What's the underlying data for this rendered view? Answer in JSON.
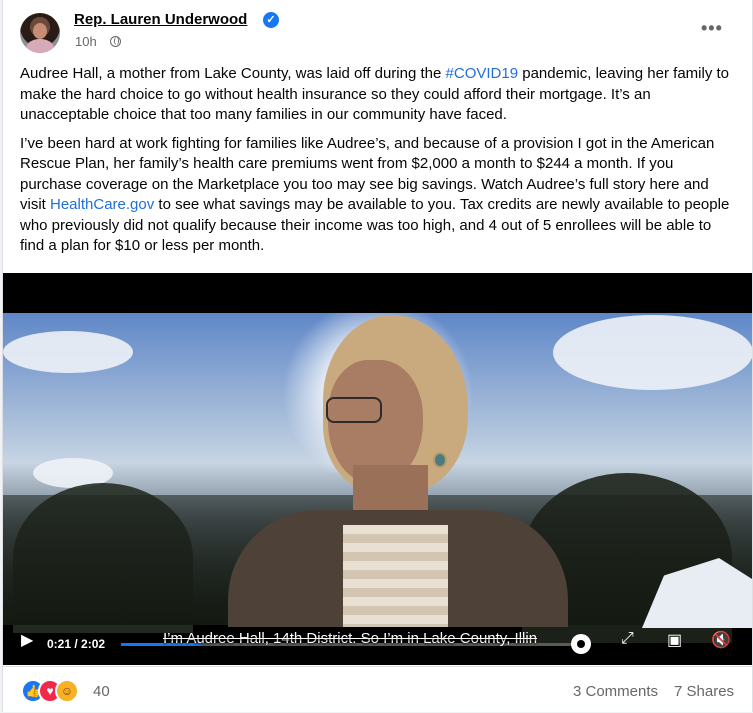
{
  "post": {
    "author": "Rep. Lauren Underwood",
    "time": "10h",
    "paragraphs": {
      "p1": {
        "before": "Audree Hall, a mother from Lake County, was laid off during the ",
        "hashtag": "#COVID19",
        "after": " pandemic, leaving her family to make the hard choice to go without health insurance so they could afford their mortgage. It’s an unacceptable choice that too many families in our community have faced."
      },
      "p2": {
        "before": "I’ve been hard at work fighting for families like Audree’s, and because of a provision I got in the American Rescue Plan, her family’s health care premiums went from $2,000 a month to $244 a month. If you purchase coverage on the Marketplace you too may see big savings. Watch Audree’s full story here and visit ",
        "link": "HealthCare.gov",
        "after": " to see what savings may be available to you. Tax credits are newly available to people who previously did not qualify because their income was too high, and 4 out of 5 enrollees will be able to find a plan for $10 or less per month."
      }
    }
  },
  "video": {
    "timecode": "0:21 / 2:02",
    "progress_fraction": 0.17,
    "caption": "I’m Audree Hall, 14th District. So I’m in Lake County, Illin"
  },
  "footer": {
    "reaction_count": "40",
    "comments": "3 Comments",
    "shares": "7 Shares"
  },
  "colors": {
    "accent": "#1877f2",
    "link": "#216fdb"
  },
  "icons": [
    "verified-icon",
    "public-globe-icon",
    "more-options-icon",
    "play-icon",
    "settings-icon",
    "fullscreen-icon",
    "picture-in-picture-icon",
    "mute-icon",
    "like-reaction-icon",
    "love-reaction-icon",
    "care-reaction-icon"
  ]
}
